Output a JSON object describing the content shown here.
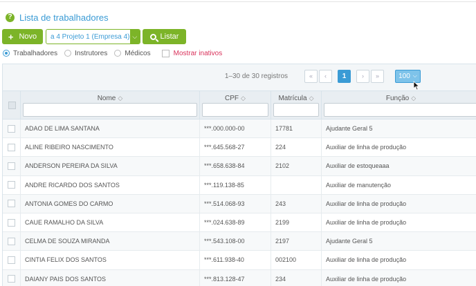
{
  "header": {
    "icon": "question-circle-icon",
    "title": "Lista de trabalhadores"
  },
  "toolbar": {
    "new_label": "Novo",
    "project_select": "a 4 Projeto 1 (Empresa 4)",
    "list_label": "Listar"
  },
  "filters": {
    "options": [
      "Trabalhadores",
      "Instrutores",
      "Médicos"
    ],
    "selected": "Trabalhadores",
    "show_inactive_label": "Mostrar inativos"
  },
  "pager": {
    "records_text": "1–30 de 30 registros",
    "current_page": "1",
    "page_size": "100"
  },
  "table": {
    "columns": [
      "Nome",
      "CPF",
      "Matrícula",
      "Função"
    ],
    "rows": [
      {
        "nome": "ADAO DE LIMA SANTANA",
        "cpf": "***.000.000-00",
        "matricula": "17781",
        "funcao": "Ajudante Geral 5"
      },
      {
        "nome": "ALINE RIBEIRO NASCIMENTO",
        "cpf": "***.645.568-27",
        "matricula": "224",
        "funcao": "Auxiliar de linha de produção"
      },
      {
        "nome": "ANDERSON PEREIRA DA SILVA",
        "cpf": "***.658.638-84",
        "matricula": "2102",
        "funcao": "Auxiliar de estoqueaaa"
      },
      {
        "nome": "ANDRE RICARDO DOS SANTOS",
        "cpf": "***.119.138-85",
        "matricula": "",
        "funcao": "Auxiliar de manutenção"
      },
      {
        "nome": "ANTONIA GOMES DO CARMO",
        "cpf": "***.514.068-93",
        "matricula": "243",
        "funcao": "Auxiliar de linha de produção"
      },
      {
        "nome": "CAUE RAMALHO DA SILVA",
        "cpf": "***.024.638-89",
        "matricula": "2199",
        "funcao": "Auxiliar de linha de produção"
      },
      {
        "nome": "CELMA DE SOUZA MIRANDA",
        "cpf": "***.543.108-00",
        "matricula": "2197",
        "funcao": "Ajudante Geral 5"
      },
      {
        "nome": "CINTIA FELIX DOS SANTOS",
        "cpf": "***.611.938-40",
        "matricula": "002100",
        "funcao": "Auxiliar de linha de produção"
      },
      {
        "nome": "DAIANY PAIS DOS SANTOS",
        "cpf": "***.813.128-47",
        "matricula": "234",
        "funcao": "Auxiliar de linha de produção"
      }
    ]
  },
  "colors": {
    "accent_green": "#7cb428",
    "link_blue": "#3a9bd5",
    "inactive_red": "#d9315a"
  }
}
